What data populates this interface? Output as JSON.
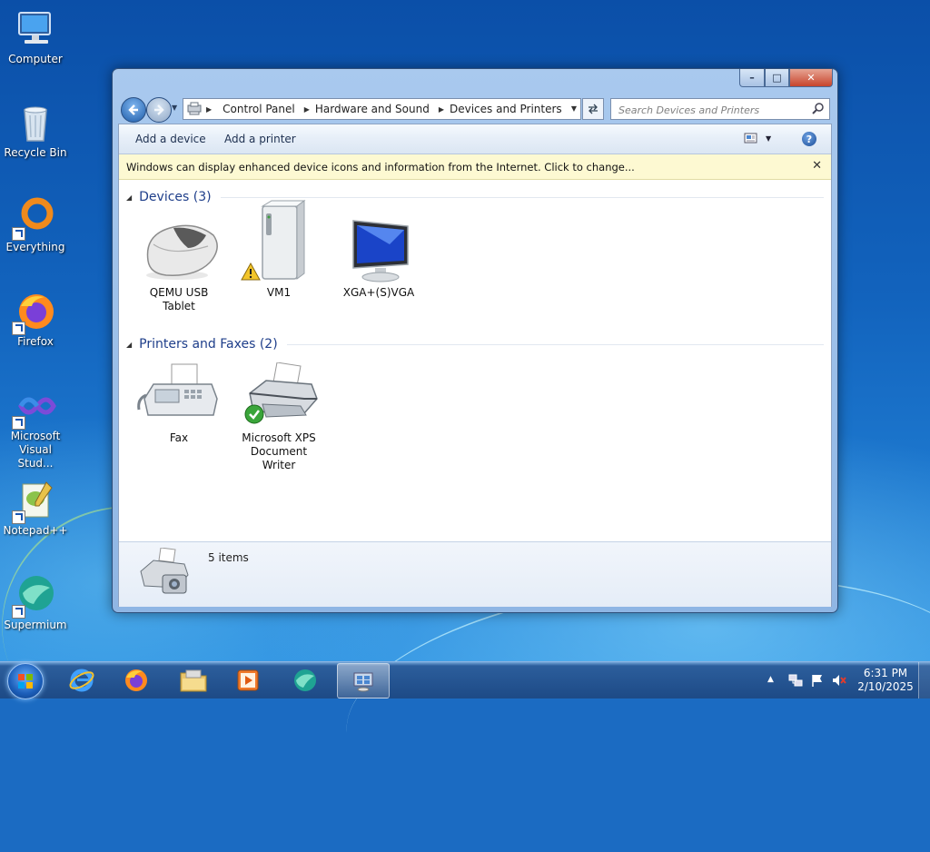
{
  "desktop": {
    "icons": [
      {
        "label": "Computer"
      },
      {
        "label": "Recycle Bin"
      },
      {
        "label": "Everything"
      },
      {
        "label": "Firefox"
      },
      {
        "label": "Microsoft Visual Stud..."
      },
      {
        "label": "Notepad++"
      },
      {
        "label": "Supermium"
      }
    ]
  },
  "window": {
    "controls": {
      "minimize": "–",
      "maximize": "□",
      "close": "✕"
    },
    "address": {
      "crumbs": [
        "Control Panel",
        "Hardware and Sound",
        "Devices and Printers"
      ]
    },
    "search": {
      "placeholder": "Search Devices and Printers"
    },
    "toolbar": {
      "add_device": "Add a device",
      "add_printer": "Add a printer",
      "help": "?"
    },
    "infobar": {
      "text": "Windows can display enhanced device icons and information from the Internet. Click to change...",
      "close": "✕"
    },
    "groups": [
      {
        "title": "Devices (3)",
        "items": [
          {
            "label": "QEMU USB Tablet",
            "icon": "mouse-icon"
          },
          {
            "label": "VM1",
            "icon": "computer-tower-icon",
            "badge": "warning"
          },
          {
            "label": "XGA+(S)VGA",
            "icon": "monitor-icon"
          }
        ]
      },
      {
        "title": "Printers and Faxes (2)",
        "items": [
          {
            "label": "Fax",
            "icon": "fax-icon"
          },
          {
            "label": "Microsoft XPS Document Writer",
            "icon": "printer-icon",
            "badge": "default-check"
          }
        ]
      }
    ],
    "details": {
      "count": "5 items"
    }
  },
  "taskbar": {
    "pinned": [
      "internet-explorer-icon",
      "firefox-icon",
      "file-explorer-icon",
      "media-player-icon",
      "supermium-icon",
      "devices-and-printers-icon"
    ],
    "active_item": "devices-and-printers-icon",
    "clock": {
      "time": "6:31 PM",
      "date": "2/10/2025"
    }
  },
  "colors": {
    "accent": "#1e3e8a",
    "infobar": "#fdf9d2",
    "desktop": "#1263bd"
  }
}
